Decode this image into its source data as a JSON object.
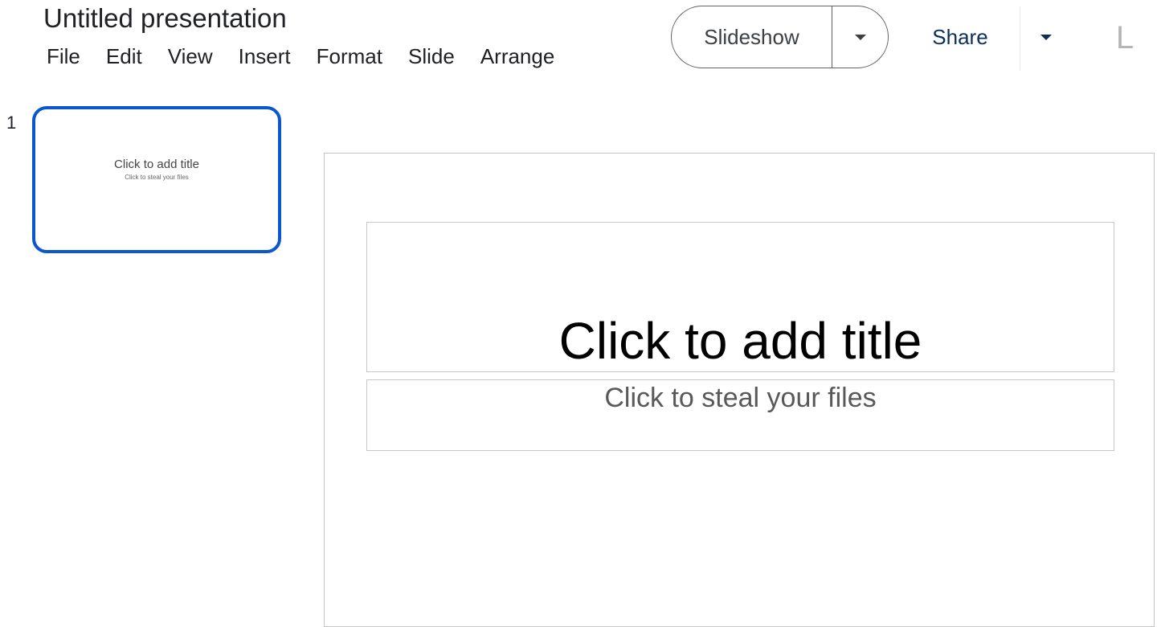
{
  "document": {
    "title": "Untitled presentation"
  },
  "menu": {
    "items": [
      {
        "label": "File"
      },
      {
        "label": "Edit"
      },
      {
        "label": "View"
      },
      {
        "label": "Insert"
      },
      {
        "label": "Format"
      },
      {
        "label": "Slide"
      },
      {
        "label": "Arrange"
      }
    ]
  },
  "toolbar": {
    "slideshow_label": "Slideshow",
    "slideshow_dropdown_icon": "caret-down-icon",
    "share_label": "Share",
    "share_dropdown_icon": "caret-down-icon",
    "avatar_initial": "L"
  },
  "filmstrip": {
    "slides": [
      {
        "number": "1",
        "title": "Click to add title",
        "subtitle": "Click to steal your files"
      }
    ]
  },
  "slide": {
    "title_placeholder": "Click to add title",
    "subtitle_placeholder": "Click to steal your files"
  },
  "colors": {
    "selection_accent": "#0b57d0",
    "share_text": "#0b2f5b",
    "placeholder_border": "#c7c7c7"
  }
}
